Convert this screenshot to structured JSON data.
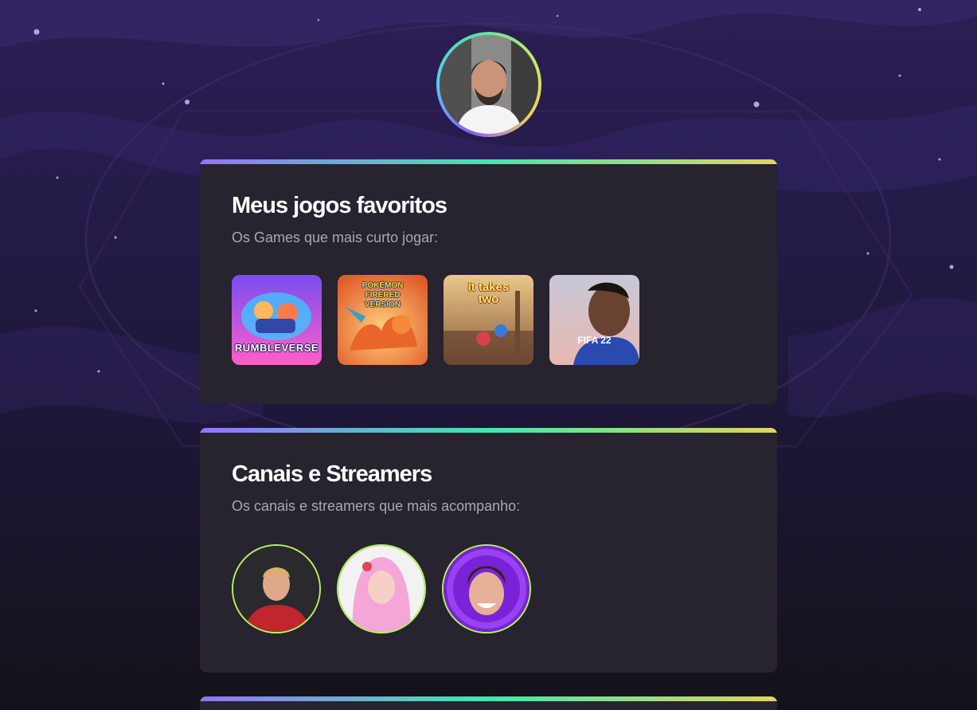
{
  "profile": {
    "avatar_icon": "profile-avatar-photo"
  },
  "games_section": {
    "title": "Meus jogos favoritos",
    "subtitle": "Os Games que mais curto jogar:",
    "games": [
      {
        "name": "RUMBLEVERSE",
        "icon": "rumbleverse-cover"
      },
      {
        "name": "POKÉMON FIRERED VERSION",
        "icon": "pokemon-firered-cover"
      },
      {
        "name": "it takes two",
        "icon": "it-takes-two-cover"
      },
      {
        "name": "FIFA 22",
        "icon": "fifa-22-cover"
      }
    ]
  },
  "streamers_section": {
    "title": "Canais e Streamers",
    "subtitle": "Os canais e streamers que mais acompanho:",
    "streamers": [
      {
        "icon": "streamer-avatar-1"
      },
      {
        "icon": "streamer-avatar-2"
      },
      {
        "icon": "streamer-avatar-3"
      }
    ]
  },
  "colors": {
    "background": "#231a45",
    "card": "#27232f",
    "gradient_start": "#9572fc",
    "gradient_mid": "#43e7ad",
    "gradient_end": "#e1d55d",
    "streamer_border": "#b4f35a",
    "title": "#ffffff",
    "subtitle": "#a8a8b3"
  }
}
